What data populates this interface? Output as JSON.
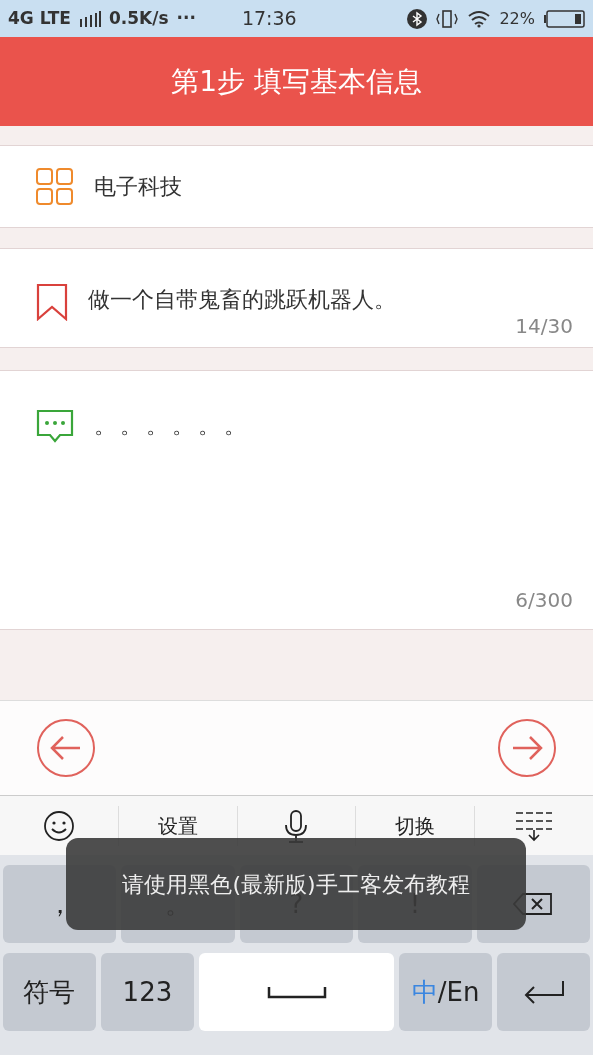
{
  "status_bar": {
    "network": "4G LTE",
    "speed": "0.5K/s",
    "more": "···",
    "time": "17:36",
    "battery": "22%"
  },
  "header": {
    "title": "第1步 填写基本信息"
  },
  "category": {
    "value": "电子科技"
  },
  "title_field": {
    "value": "做一个自带鬼畜的跳跃机器人。",
    "counter": "14/30"
  },
  "description_field": {
    "value": "。。。。。。",
    "counter": "6/300"
  },
  "keyboard": {
    "toolbar": [
      {
        "kind": "emoji"
      },
      {
        "kind": "text",
        "label": "设置"
      },
      {
        "kind": "mic"
      },
      {
        "kind": "text",
        "label": "切换"
      },
      {
        "kind": "hide"
      }
    ],
    "row_1": [
      {
        "kind": "char",
        "label": "，"
      },
      {
        "kind": "char",
        "label": "。"
      },
      {
        "kind": "char",
        "label": "?"
      },
      {
        "kind": "char",
        "label": "!"
      },
      {
        "kind": "backspace"
      }
    ],
    "row_2": [
      {
        "kind": "char",
        "label": "符号"
      },
      {
        "kind": "char",
        "label": "123"
      },
      {
        "kind": "space"
      },
      {
        "kind": "lang",
        "accent": "中",
        "label": "/En"
      },
      {
        "kind": "enter"
      }
    ]
  },
  "toast": {
    "text": "请使用黑色(最新版)手工客发布教程"
  }
}
